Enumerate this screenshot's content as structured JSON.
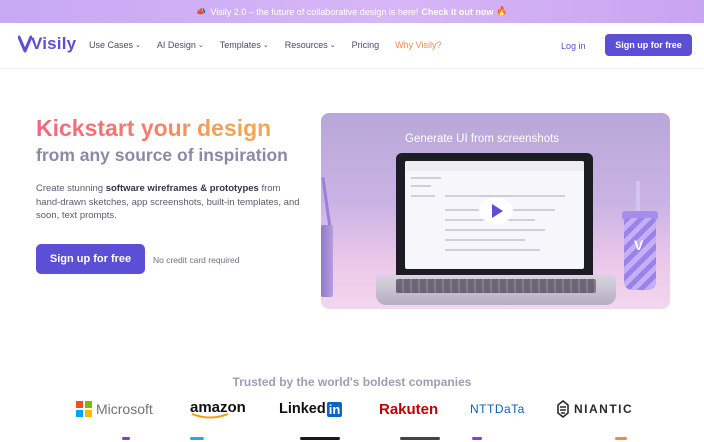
{
  "banner": {
    "text": "Visily 2.0 – the future of collaborative design is here!",
    "cta": "Check it out now",
    "icon": "announcement-icon",
    "fire_icon": "fire-icon"
  },
  "nav": {
    "logo_text": "Visily",
    "menu": [
      {
        "label": "Use Cases",
        "has_dropdown": true
      },
      {
        "label": "AI Design",
        "has_dropdown": true
      },
      {
        "label": "Templates",
        "has_dropdown": true
      },
      {
        "label": "Resources",
        "has_dropdown": true
      },
      {
        "label": "Pricing",
        "has_dropdown": false
      },
      {
        "label": "Why Visily?",
        "has_dropdown": false
      }
    ],
    "login": "Log in",
    "signup": "Sign up for free"
  },
  "hero": {
    "title": "Kickstart your design",
    "subtitle": "from any source of inspiration",
    "desc_prefix": "Create stunning ",
    "desc_bold": "software wireframes & prototypes",
    "desc_suffix": " from hand-drawn sketches, app screenshots, built-in templates, and soon, text prompts.",
    "cta": "Sign up for free",
    "note": "No credit card required"
  },
  "video": {
    "caption": "Generate UI from screenshots",
    "play_icon": "play-icon"
  },
  "trusted": {
    "heading": "Trusted by the world's boldest companies",
    "logos": [
      "Microsoft",
      "amazon",
      "Linked",
      "in",
      "Rakuten",
      "NTTDaTa",
      "NIANTIC"
    ]
  },
  "colors": {
    "brand": "#5b4fd6",
    "accent_orange": "#f08a4b",
    "banner_bg": "#d3b2f6"
  }
}
